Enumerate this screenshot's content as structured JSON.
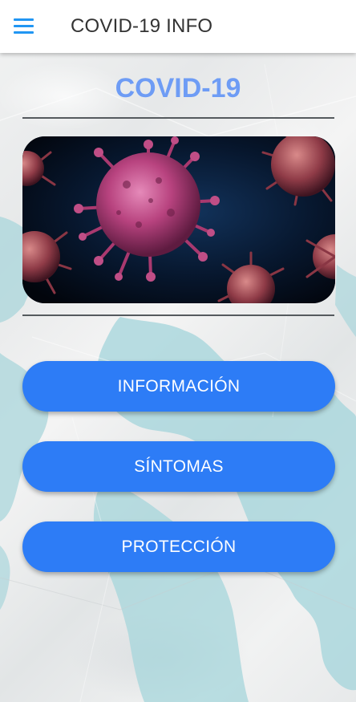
{
  "header": {
    "menu_icon": "hamburger-menu-icon",
    "title": "COVID-19 INFO"
  },
  "main": {
    "title": "COVID-19",
    "hero_image": "coronavirus-illustration",
    "buttons": [
      {
        "label": "INFORMACIÓN"
      },
      {
        "label": "SÍNTOMAS"
      },
      {
        "label": "PROTECCIÓN"
      }
    ]
  },
  "colors": {
    "accent": "#2196f3",
    "title": "#6e9cf5",
    "button": "#2d7cf6"
  }
}
